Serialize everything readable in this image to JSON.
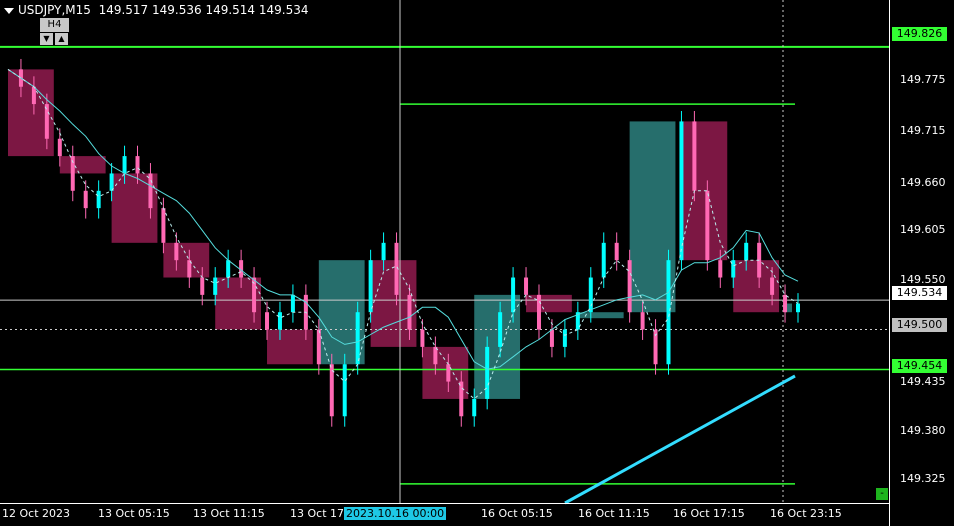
{
  "header": {
    "symbol": "USDJPY,M15",
    "ohlc": "149.517 149.536 149.514 149.534"
  },
  "h4_button": {
    "label": "H4",
    "down": "▼",
    "up": "▲"
  },
  "price_labels": [
    {
      "text": "149.826",
      "bg": "#33ff33",
      "fg": "#000000"
    },
    {
      "text": "149.534",
      "bg": "#ffffff",
      "fg": "#000000"
    },
    {
      "text": "149.500",
      "bg": "#c0c0c0",
      "fg": "#000000"
    },
    {
      "text": "149.454",
      "bg": "#33ff33",
      "fg": "#000000"
    }
  ],
  "y_ticks": [
    "149.775",
    "149.715",
    "149.660",
    "149.605",
    "149.550",
    "149.435",
    "149.380",
    "149.325"
  ],
  "x_ticks": [
    "12 Oct 2023",
    "13 Oct 05:15",
    "13 Oct 11:15",
    "13 Oct 17",
    "2023.10.16 00:00",
    "16 Oct 05:15",
    "16 Oct 11:15",
    "16 Oct 17:15",
    "16 Oct 23:15"
  ],
  "minus_button": "-",
  "colors": {
    "bull": "#00ffff",
    "bear": "#ff69b4",
    "box_bull": "#2a7a78",
    "box_bear": "#8a1a4a",
    "level": "#33ff33",
    "ma": "#55dddd"
  },
  "chart_data": {
    "type": "candlestick",
    "symbol": "USDJPY",
    "timeframe": "M15",
    "ylim": [
      149.3,
      149.88
    ],
    "x": [
      "12 Oct 2023",
      "13 Oct 05:15",
      "13 Oct 11:15",
      "13 Oct 17",
      "2023.10.16 00:00",
      "16 Oct 05:15",
      "16 Oct 11:15",
      "16 Oct 17:15",
      "16 Oct 23:15"
    ],
    "levels": [
      149.826,
      149.76,
      149.454,
      149.322
    ],
    "current_price": 149.534,
    "crosshair_price": 149.5,
    "series": [
      {
        "values": [
          149.8,
          149.78,
          149.76,
          149.72,
          149.7,
          149.66,
          149.64,
          149.66,
          149.68,
          149.7,
          149.68,
          149.64,
          149.6,
          149.58,
          149.56,
          149.54,
          149.56,
          149.58,
          149.56,
          149.52,
          149.5,
          149.52,
          149.54,
          149.5,
          149.46,
          149.4,
          149.46,
          149.52,
          149.58,
          149.6,
          149.54,
          149.5,
          149.48,
          149.46,
          149.44,
          149.4,
          149.42,
          149.48,
          149.52,
          149.56,
          149.54,
          149.5,
          149.48,
          149.5,
          149.52,
          149.56,
          149.6,
          149.58,
          149.52,
          149.5,
          149.46,
          149.58,
          149.74,
          149.66,
          149.58,
          149.56,
          149.58,
          149.6,
          149.56,
          149.54,
          149.52,
          149.53
        ]
      }
    ]
  }
}
